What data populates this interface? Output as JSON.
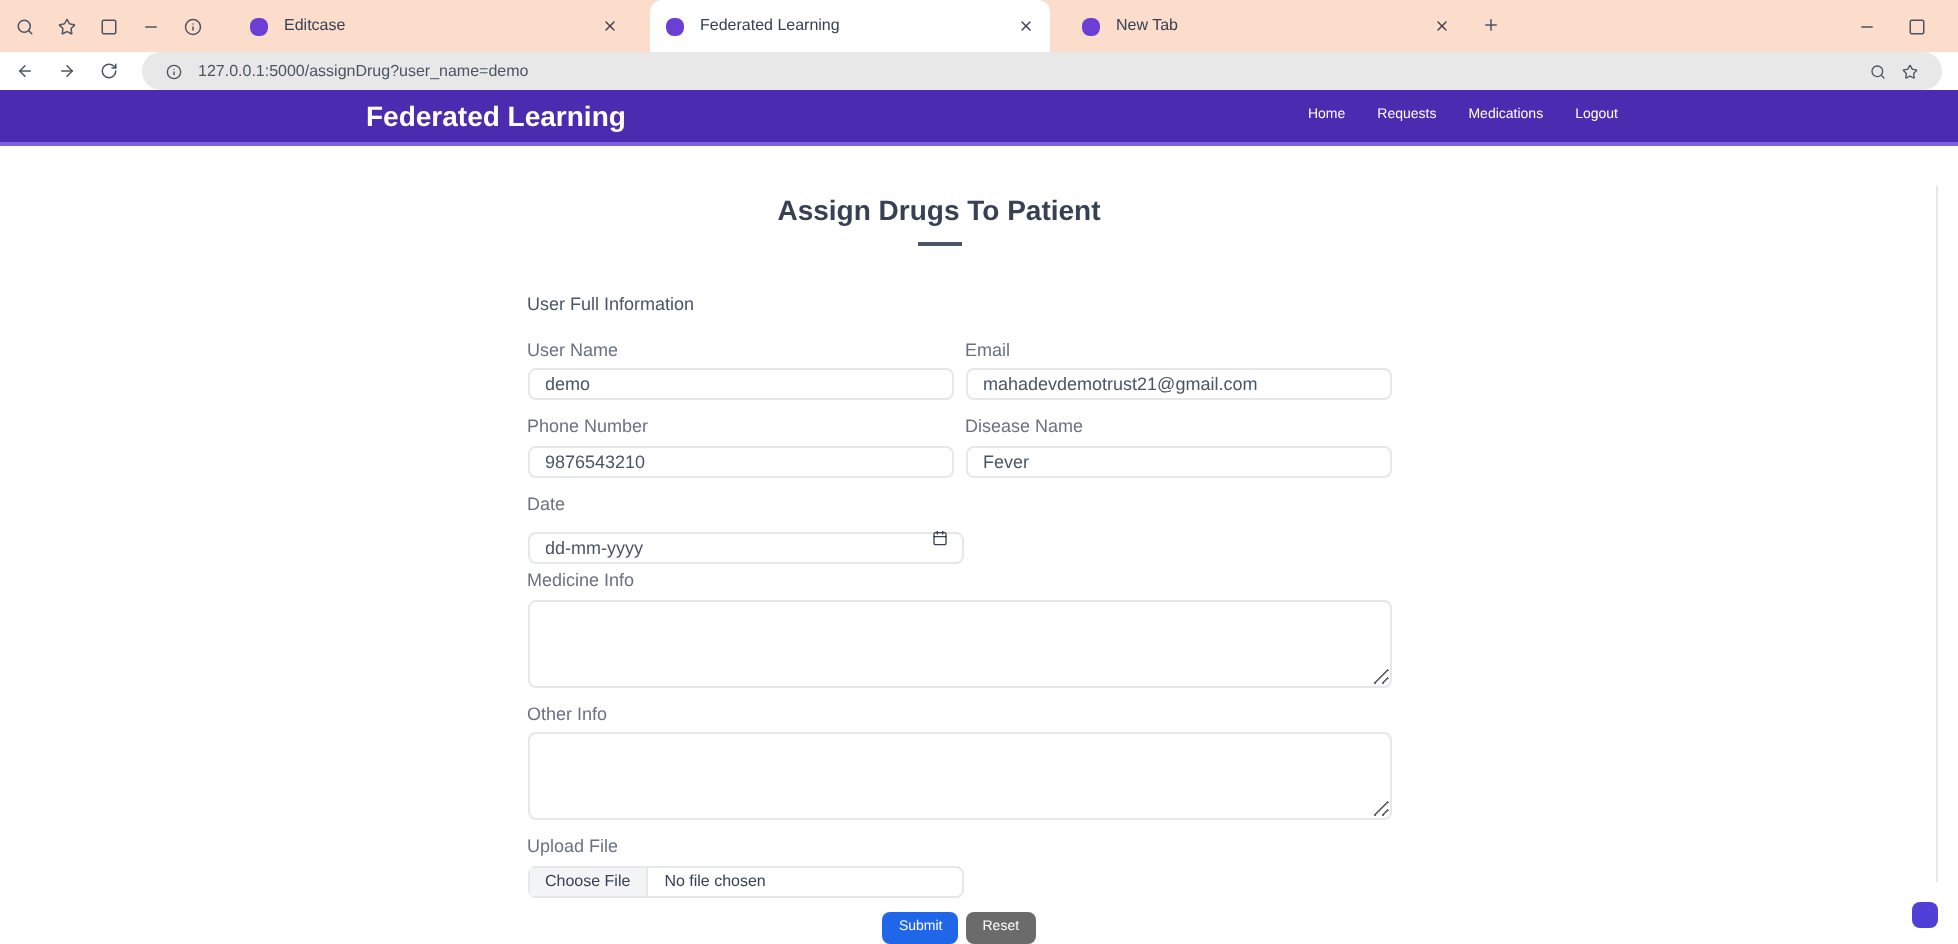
{
  "browser": {
    "tabs": [
      {
        "title": "Editcase",
        "selected": false
      },
      {
        "title": "Federated Learning",
        "selected": true
      },
      {
        "title": "New Tab",
        "selected": false
      }
    ],
    "url": "127.0.0.1:5000/assignDrug?user_name=demo"
  },
  "navbar": {
    "brand": "Federated Learning",
    "links": [
      "Home",
      "Requests",
      "Medications",
      "Logout"
    ]
  },
  "page": {
    "title": "Assign Drugs To Patient"
  },
  "form": {
    "section": "User Full Information",
    "fields": [
      {
        "kind": "input",
        "label": "User Name",
        "value": "demo"
      },
      {
        "kind": "input",
        "label": "Email",
        "value": "mahadevdemotrust21@gmail.com"
      },
      {
        "kind": "input",
        "label": "Phone Number",
        "value": "9876543210"
      },
      {
        "kind": "input",
        "label": "Disease Name",
        "value": "Fever"
      },
      {
        "kind": "date",
        "label": "Date",
        "placeholder": "dd-mm-yyyy"
      },
      {
        "kind": "textarea",
        "label": "Medicine Info"
      },
      {
        "kind": "textarea",
        "label": "Other Info"
      },
      {
        "kind": "file",
        "label": "Upload File",
        "button": "Choose File",
        "status": "No file chosen"
      }
    ],
    "buttons": [
      {
        "label": "Submit",
        "kind": "primary"
      },
      {
        "label": "Reset",
        "kind": "secondary"
      }
    ]
  }
}
